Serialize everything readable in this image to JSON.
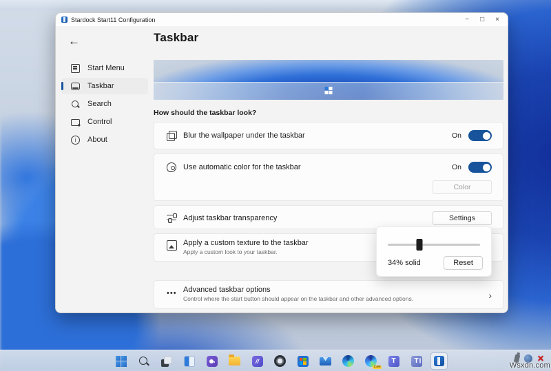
{
  "colors": {
    "accent": "#17549b",
    "toggle_on": "#17549b",
    "selection_bar": "#17549b"
  },
  "window": {
    "title": "Stardock Start11 Configuration",
    "controls": {
      "minimize": "−",
      "maximize": "□",
      "close": "×"
    }
  },
  "page": {
    "back_glyph": "←",
    "title": "Taskbar",
    "section_heading": "How should the taskbar look?"
  },
  "sidebar": {
    "items": [
      {
        "label": "Start Menu",
        "icon": "start-menu-icon",
        "selected": false
      },
      {
        "label": "Taskbar",
        "icon": "taskbar-icon",
        "selected": true
      },
      {
        "label": "Search",
        "icon": "search-icon",
        "selected": false
      },
      {
        "label": "Control",
        "icon": "control-icon",
        "selected": false
      },
      {
        "label": "About",
        "icon": "info-icon",
        "selected": false
      }
    ],
    "about_icon_glyph": "i"
  },
  "rows": {
    "blur": {
      "label": "Blur the wallpaper under the taskbar",
      "state": "On",
      "icon": "blur-icon"
    },
    "auto_color": {
      "label": "Use automatic color for the taskbar",
      "state": "On",
      "button": "Color",
      "button_disabled": true,
      "icon": "palette-icon"
    },
    "transparency": {
      "label": "Adjust taskbar transparency",
      "button": "Settings",
      "icon": "sliders-icon"
    },
    "texture": {
      "label": "Apply a custom texture to the taskbar",
      "description": "Apply a custom look to your taskbar.",
      "icon": "image-icon"
    },
    "advanced": {
      "label": "Advanced taskbar options",
      "description": "Control where the start button should appear on the taskbar and other advanced options.",
      "icon_glyph": "•••",
      "chevron": "›"
    }
  },
  "popup": {
    "value_label": "34% solid",
    "reset_label": "Reset",
    "slider_percent": 34
  },
  "os_taskbar": {
    "icons": [
      "windows-start-icon",
      "search-icon",
      "task-view-icon",
      "widgets-icon",
      "chat-icon",
      "file-explorer-icon",
      "movies-tv-icon",
      "camera-app-icon",
      "microsoft-store-icon",
      "mail-icon",
      "edge-icon",
      "edge-canary-icon",
      "teams-icon",
      "teams-alt-icon",
      "start11-icon"
    ],
    "glyphs": {
      "movies": "//",
      "teams": "T",
      "teams_alt": "T",
      "canary": "CAN"
    },
    "tray_icons": [
      "pen-icon",
      "network-globe-icon",
      "error-x-icon"
    ],
    "tray_x_glyph": "✕"
  },
  "watermark": "Wsxdn.com"
}
